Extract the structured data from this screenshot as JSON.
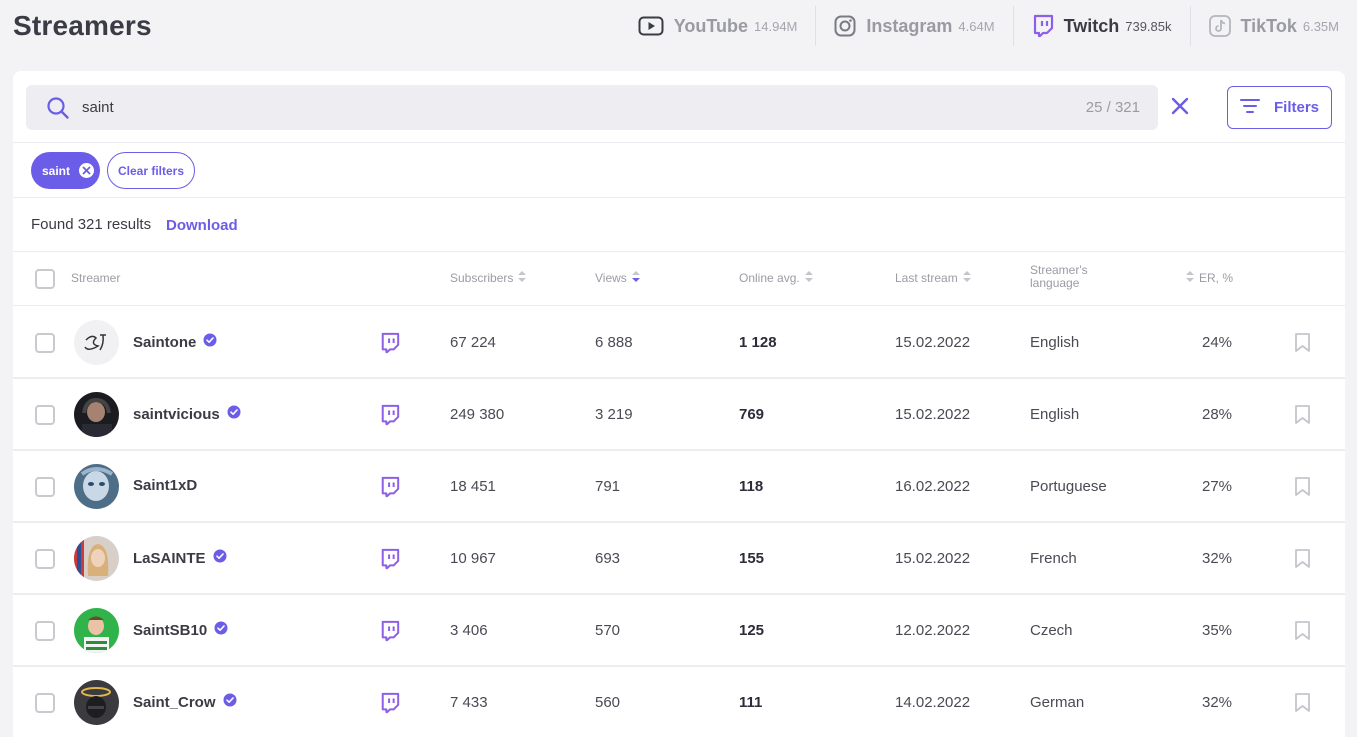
{
  "page": {
    "title": "Streamers"
  },
  "platforms": [
    {
      "name": "YouTube",
      "count": "14.94M",
      "icon": "youtube-icon",
      "active": false
    },
    {
      "name": "Instagram",
      "count": "4.64M",
      "icon": "instagram-icon",
      "active": false
    },
    {
      "name": "Twitch",
      "count": "739.85k",
      "icon": "twitch-icon",
      "active": true
    },
    {
      "name": "TikTok",
      "count": "6.35M",
      "icon": "tiktok-icon",
      "active": false
    }
  ],
  "search": {
    "value": "saint",
    "count": "25 / 321"
  },
  "filters": {
    "label": "Filters"
  },
  "chips": {
    "active": "saint",
    "clear": "Clear filters"
  },
  "results": {
    "text": "Found 321 results",
    "download": "Download"
  },
  "table": {
    "headers": {
      "streamer": "Streamer",
      "subscribers": "Subscribers",
      "views": "Views",
      "online": "Online avg.",
      "last_stream": "Last stream",
      "language": "Streamer's language",
      "er": "ER, %"
    },
    "rows": [
      {
        "name": "Saintone",
        "verified": true,
        "subscribers": "67 224",
        "views": "6 888",
        "online": "1 128",
        "last_stream": "15.02.2022",
        "language": "English",
        "er": "24%"
      },
      {
        "name": "saintvicious",
        "verified": true,
        "subscribers": "249 380",
        "views": "3 219",
        "online": "769",
        "last_stream": "15.02.2022",
        "language": "English",
        "er": "28%"
      },
      {
        "name": "Saint1xD",
        "verified": false,
        "subscribers": "18 451",
        "views": "791",
        "online": "118",
        "last_stream": "16.02.2022",
        "language": "Portuguese",
        "er": "27%"
      },
      {
        "name": "LaSAINTE",
        "verified": true,
        "subscribers": "10 967",
        "views": "693",
        "online": "155",
        "last_stream": "15.02.2022",
        "language": "French",
        "er": "32%"
      },
      {
        "name": "SaintSB10",
        "verified": true,
        "subscribers": "3 406",
        "views": "570",
        "online": "125",
        "last_stream": "12.02.2022",
        "language": "Czech",
        "er": "35%"
      },
      {
        "name": "Saint_Crow",
        "verified": true,
        "subscribers": "7 433",
        "views": "560",
        "online": "111",
        "last_stream": "14.02.2022",
        "language": "German",
        "er": "32%"
      }
    ]
  },
  "colors": {
    "accent": "#6b5de8",
    "twitch": "#8c5fe6",
    "background": "#f3f3f6"
  }
}
